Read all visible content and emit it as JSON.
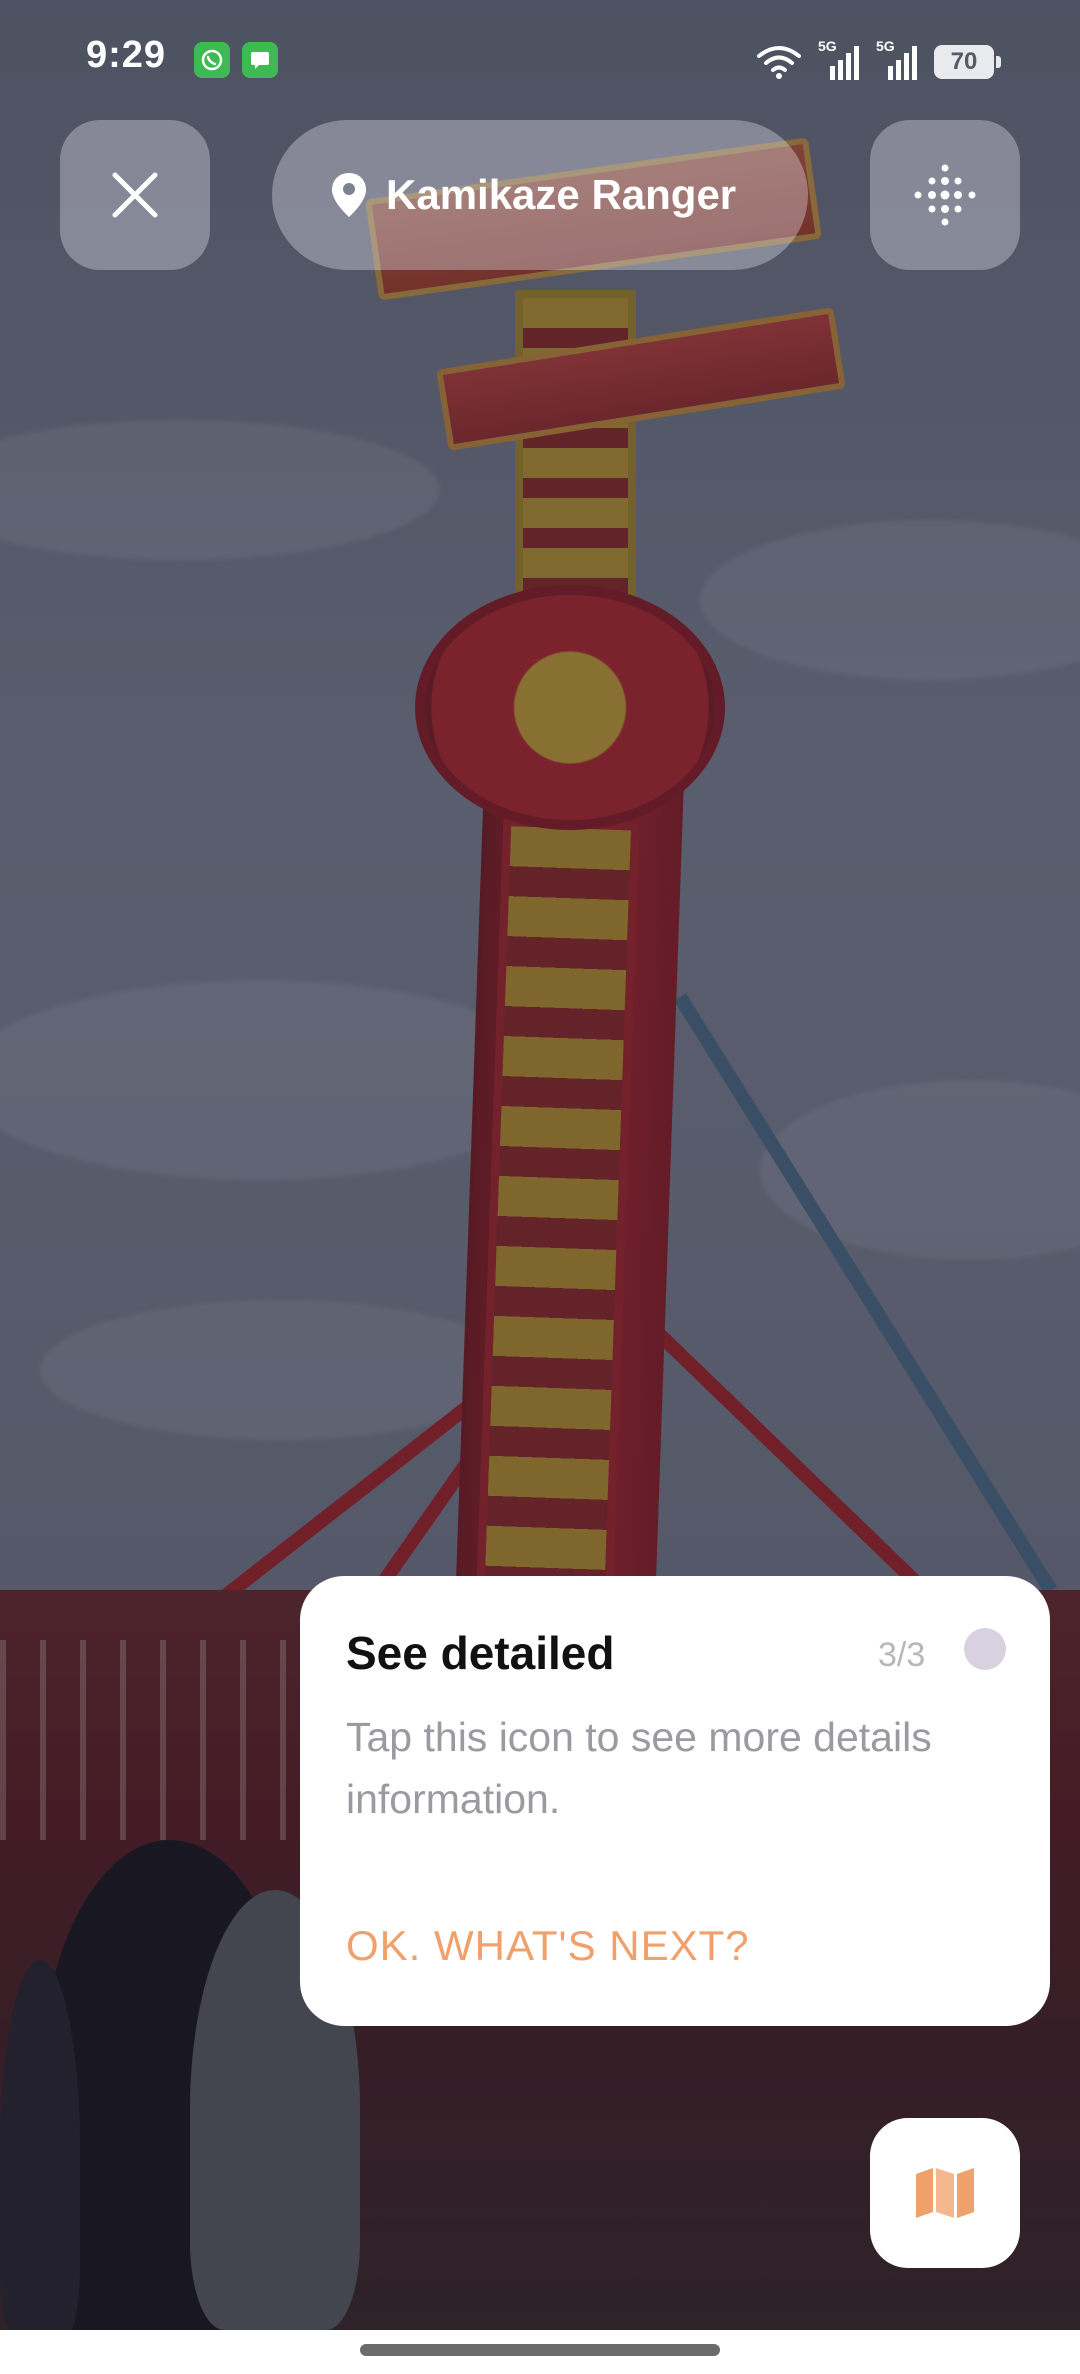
{
  "status_bar": {
    "time": "9:29",
    "network_1": "5G",
    "network_2": "5G",
    "battery": "70"
  },
  "header": {
    "location": "Kamikaze Ranger"
  },
  "tooltip": {
    "title": "See detailed",
    "step": "3/3",
    "description": "Tap this icon to see more details information.",
    "action_label": "OK. WHAT'S NEXT?"
  },
  "icons": {
    "close": "close-icon",
    "location": "location-pin-icon",
    "more": "dots-grid-icon",
    "map": "map-icon",
    "whatsapp": "whatsapp-icon",
    "messages": "messages-icon",
    "wifi": "wifi-icon"
  },
  "colors": {
    "accent": "#f0a06a",
    "notification_green": "#3dbb52"
  }
}
